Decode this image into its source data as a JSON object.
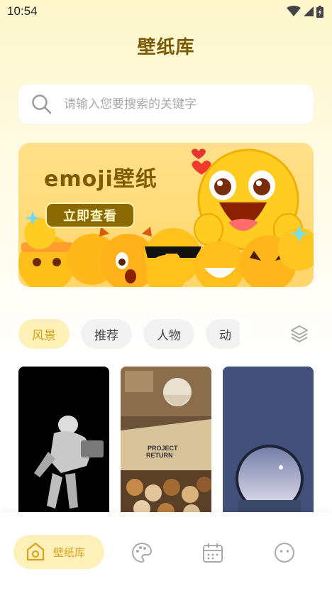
{
  "status": {
    "time": "10:54"
  },
  "header": {
    "title": "壁纸库"
  },
  "search": {
    "placeholder": "请输入您要搜索的关键字"
  },
  "banner": {
    "title": "emoji壁纸",
    "button_label": "立即查看"
  },
  "categories": [
    {
      "label": "风景",
      "active": true
    },
    {
      "label": "推荐",
      "active": false
    },
    {
      "label": "人物",
      "active": false
    },
    {
      "label": "动",
      "active": false
    }
  ],
  "tabbar": {
    "items": [
      {
        "label": "壁纸库",
        "icon": "home-icon",
        "active": true
      },
      {
        "label": "",
        "icon": "palette-icon",
        "active": false
      },
      {
        "label": "",
        "icon": "calendar-icon",
        "active": false
      },
      {
        "label": "",
        "icon": "smiley-icon",
        "active": false
      }
    ]
  },
  "colors": {
    "accent": "#d9a21f",
    "title": "#7a5a00",
    "chip_active_bg": "#fdf1b8",
    "banner_bg": "#ffd66b"
  },
  "icons": [
    "wifi-icon",
    "signal-icon",
    "battery-icon",
    "search-icon",
    "layers-icon"
  ]
}
